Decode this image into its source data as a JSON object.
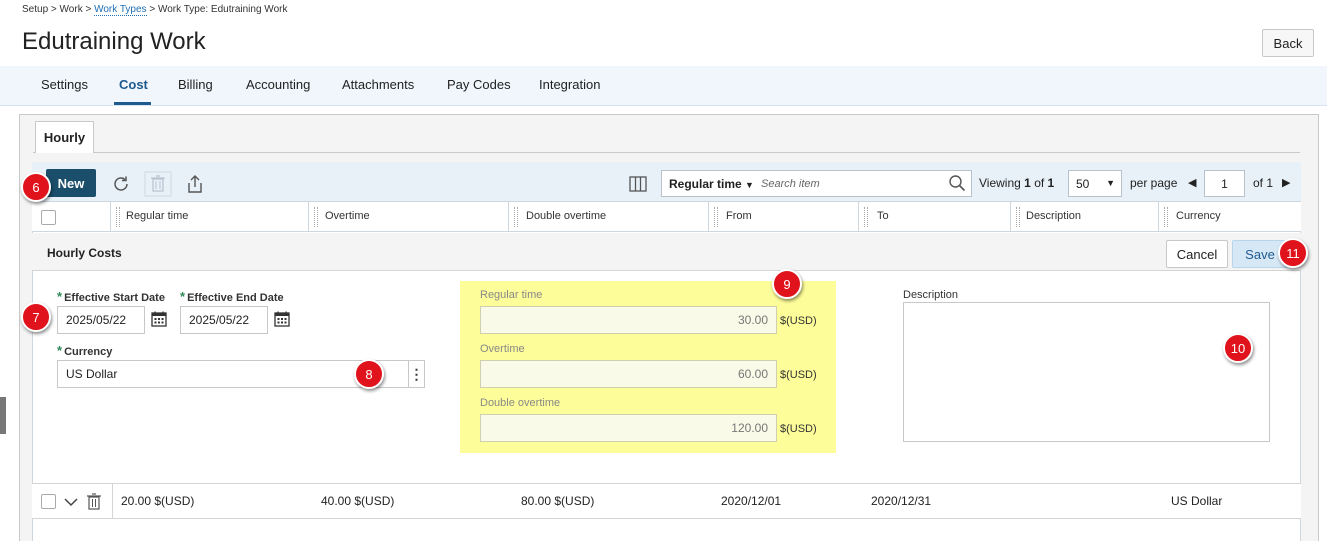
{
  "breadcrumb": {
    "setup": "Setup",
    "sep1": ">",
    "work": "Work",
    "sep2": ">",
    "work_types": "Work Types",
    "sep3": ">",
    "current": "Work Type: Edutraining Work"
  },
  "page_title": "Edutraining Work",
  "back_label": "Back",
  "tabs": [
    {
      "label": "Settings"
    },
    {
      "label": "Cost"
    },
    {
      "label": "Billing"
    },
    {
      "label": "Accounting"
    },
    {
      "label": "Attachments"
    },
    {
      "label": "Pay Codes"
    },
    {
      "label": "Integration"
    }
  ],
  "active_tab": "Cost",
  "subtab": "Hourly",
  "toolbar": {
    "new_label": "New",
    "search_field": "Regular time",
    "search_placeholder": "Search item",
    "viewing_prefix": "Viewing",
    "viewing_current": "1",
    "viewing_of": "of",
    "viewing_total": "1",
    "per_page_value": "50",
    "per_page_label": "per page",
    "page_value": "1",
    "of_pages": "of 1"
  },
  "columns": [
    "Regular time",
    "Overtime",
    "Double overtime",
    "From",
    "To",
    "Description",
    "Currency"
  ],
  "form": {
    "title": "Hourly Costs",
    "cancel_label": "Cancel",
    "save_label": "Save",
    "start_date_label": "Effective Start Date",
    "start_date_value": "2025/05/22",
    "end_date_label": "Effective End Date",
    "end_date_value": "2025/05/22",
    "currency_label": "Currency",
    "currency_value": "US Dollar",
    "regular_label": "Regular time",
    "regular_value": "30.00",
    "overtime_label": "Overtime",
    "overtime_value": "60.00",
    "double_label": "Double overtime",
    "double_value": "120.00",
    "currency_suffix": "$(USD)",
    "description_label": "Description"
  },
  "rows": [
    {
      "regular": "20.00 $(USD)",
      "overtime": "40.00 $(USD)",
      "double": "80.00 $(USD)",
      "from": "2020/12/01",
      "to": "2020/12/31",
      "description": "",
      "currency": "US Dollar"
    }
  ],
  "markers": [
    "6",
    "7",
    "8",
    "9",
    "10",
    "11"
  ],
  "colors": {
    "accent": "#1d5a8e",
    "new_button": "#1b4e6b",
    "marker": "#e0121b",
    "highlight": "#fdfd9a",
    "required": "#2e8b57"
  }
}
